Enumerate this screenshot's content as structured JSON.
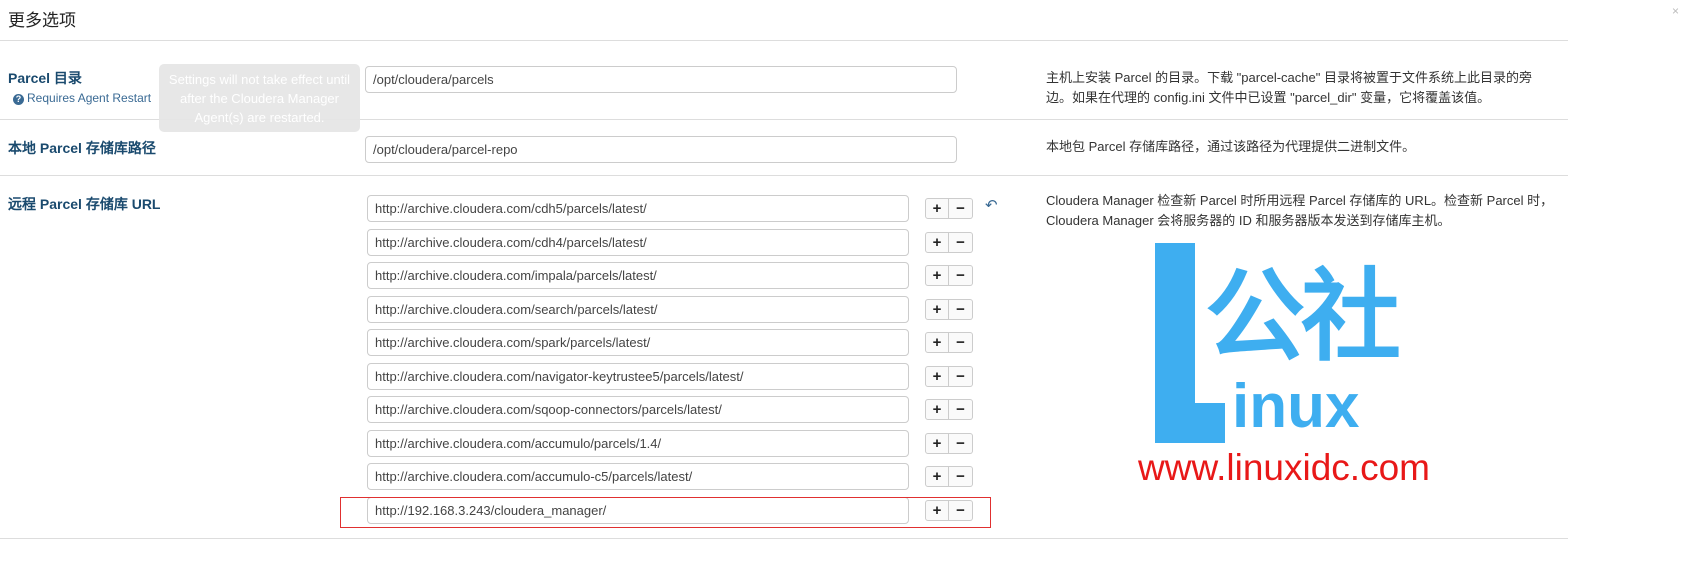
{
  "dialog": {
    "title": "更多选项",
    "close": "×"
  },
  "rows": [
    {
      "label": "Parcel 目录",
      "hint": "Requires Agent Restart",
      "value": "/opt/cloudera/parcels",
      "description": "主机上安装 Parcel 的目录。下载 \"parcel-cache\" 目录将被置于文件系统上此目录的旁边。如果在代理的 config.ini 文件中已设置 \"parcel_dir\" 变量，它将覆盖该值。"
    },
    {
      "label": "本地 Parcel 存储库路径",
      "value": "/opt/cloudera/parcel-repo",
      "description": "本地包 Parcel 存储库路径，通过该路径为代理提供二进制文件。"
    },
    {
      "label": "远程 Parcel 存储库 URL",
      "description": "Cloudera Manager 检查新 Parcel 时所用远程 Parcel 存储库的 URL。检查新 Parcel 时，Cloudera Manager 会将服务器的 ID 和服务器版本发送到存储库主机。"
    }
  ],
  "tooltip": "Settings will not take effect until after the Cloudera Manager Agent(s) are restarted.",
  "urls": [
    "http://archive.cloudera.com/cdh5/parcels/latest/",
    "http://archive.cloudera.com/cdh4/parcels/latest/",
    "http://archive.cloudera.com/impala/parcels/latest/",
    "http://archive.cloudera.com/search/parcels/latest/",
    "http://archive.cloudera.com/spark/parcels/latest/",
    "http://archive.cloudera.com/navigator-keytrustee5/parcels/latest/",
    "http://archive.cloudera.com/sqoop-connectors/parcels/latest/",
    "http://archive.cloudera.com/accumulo/parcels/1.4/",
    "http://archive.cloudera.com/accumulo-c5/parcels/latest/",
    "http://192.168.3.243/cloudera_manager/"
  ],
  "buttons": {
    "add": "+",
    "remove": "−",
    "undo": "↶"
  },
  "watermark": {
    "chars": "公社",
    "suffix": "inux",
    "url": "www.linuxidc.com"
  }
}
